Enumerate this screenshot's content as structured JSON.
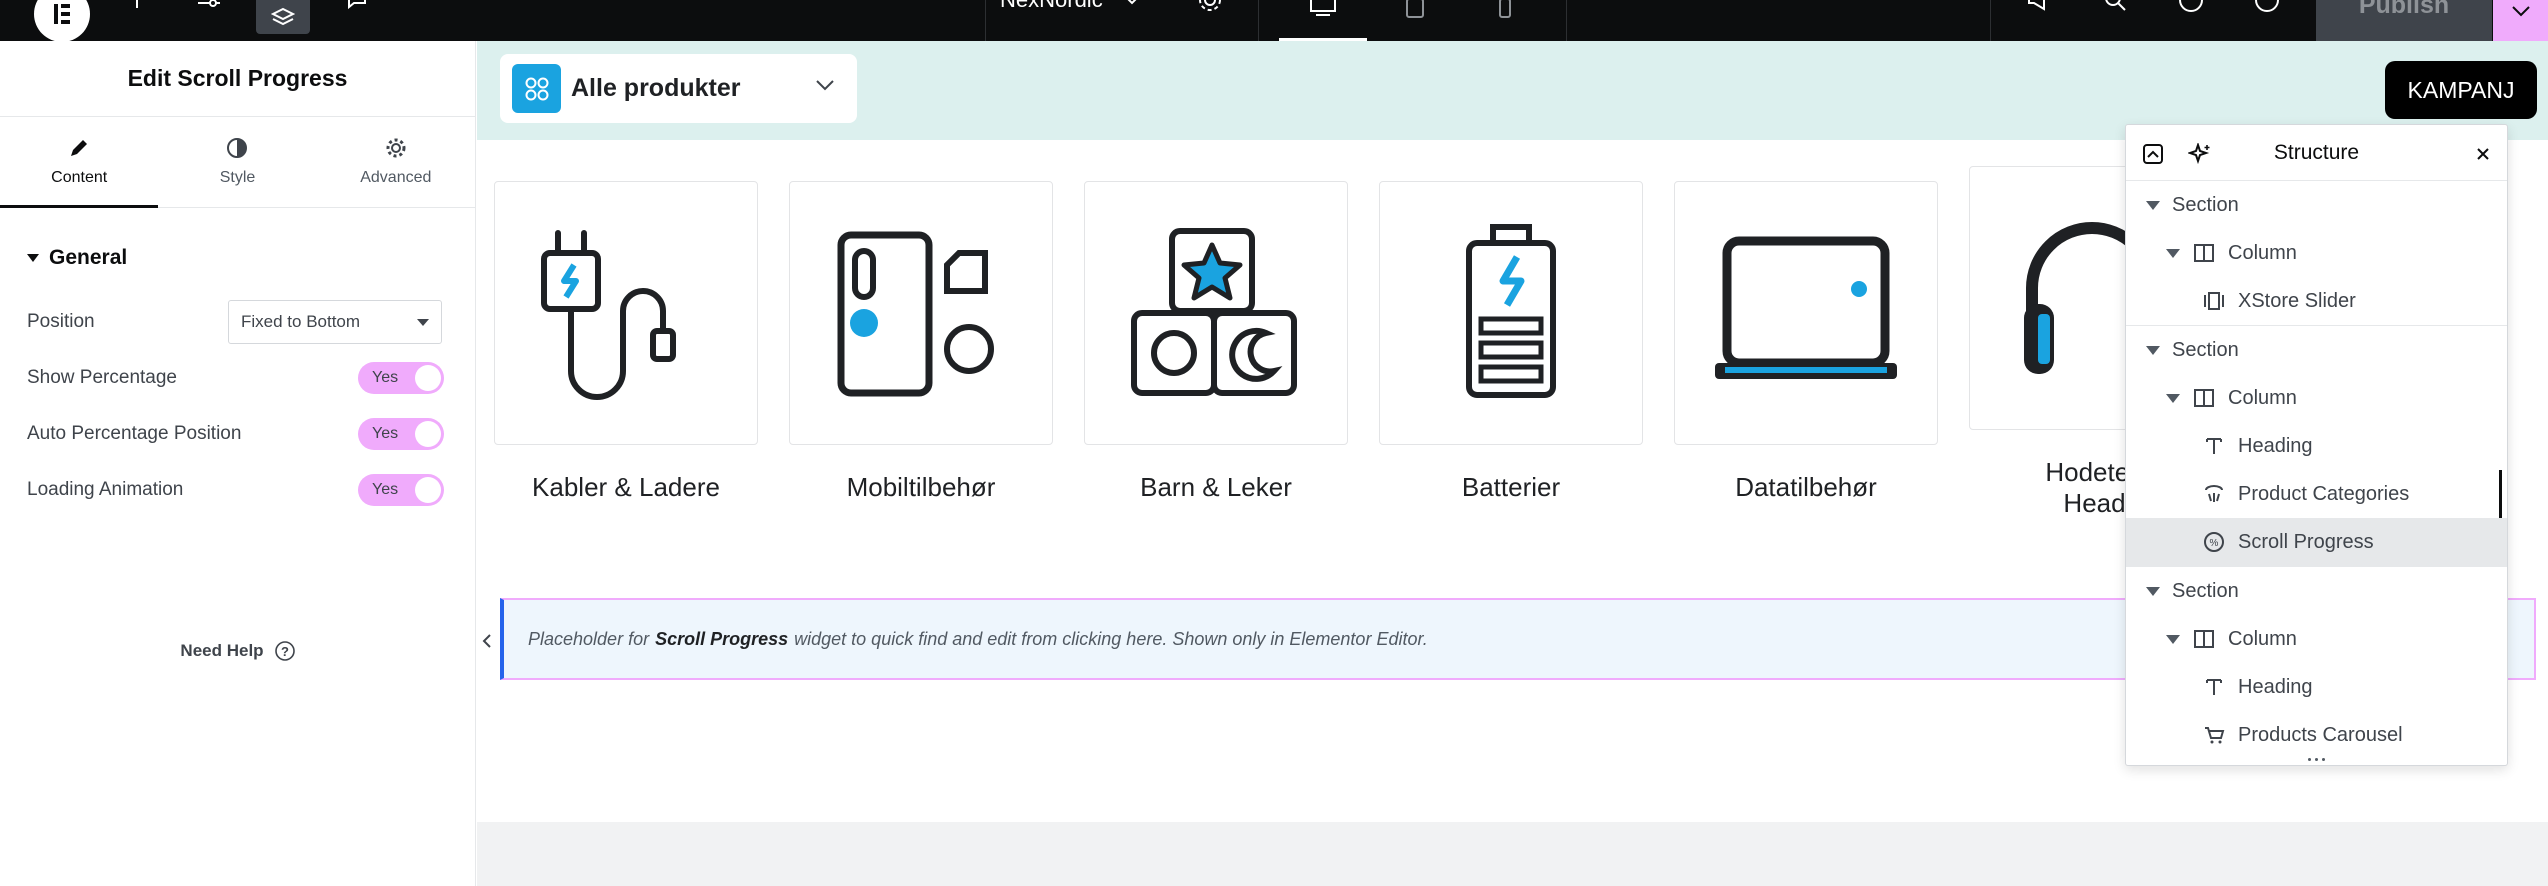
{
  "topbar": {
    "site_name": "NexNordic",
    "publish_label": "Publish"
  },
  "panel": {
    "title": "Edit Scroll Progress",
    "tabs": [
      {
        "label": "Content",
        "icon": "pencil-icon"
      },
      {
        "label": "Style",
        "icon": "contrast-icon"
      },
      {
        "label": "Advanced",
        "icon": "gear-icon"
      }
    ],
    "section_title": "General",
    "position": {
      "label": "Position",
      "value": "Fixed to Bottom"
    },
    "show_percentage": {
      "label": "Show Percentage",
      "value": "Yes"
    },
    "auto_percentage": {
      "label": "Auto Percentage Position",
      "value": "Yes"
    },
    "loading_animation": {
      "label": "Loading Animation",
      "value": "Yes"
    },
    "need_help": "Need Help"
  },
  "canvas": {
    "dropdown_label": "Alle produkter",
    "kampanj_label": "KAMPANJ",
    "categories": [
      {
        "label": "Kabler & Ladere",
        "icon": "charger-cable-icon"
      },
      {
        "label": "Mobiltilbehør",
        "icon": "phone-accessories-icon"
      },
      {
        "label": "Barn & Leker",
        "icon": "toy-blocks-icon"
      },
      {
        "label": "Batterier",
        "icon": "battery-icon"
      },
      {
        "label": "Datatilbehør",
        "icon": "laptop-icon"
      },
      {
        "label": "Hodetelef\nHeads",
        "icon": "headphones-icon"
      }
    ],
    "placeholder": {
      "prefix": "Placeholder for",
      "widget": "Scroll Progress",
      "suffix": "widget to quick find and edit from clicking here. Shown only in Elementor Editor."
    }
  },
  "structure": {
    "title": "Structure",
    "items": [
      {
        "label": "Section",
        "level": 0,
        "icon": "caret-down-icon"
      },
      {
        "label": "Column",
        "level": 1,
        "icon": "column-icon"
      },
      {
        "label": "XStore Slider",
        "level": 2,
        "icon": "slider-icon"
      },
      {
        "label": "Section",
        "level": 0,
        "icon": "caret-down-icon"
      },
      {
        "label": "Column",
        "level": 1,
        "icon": "column-icon"
      },
      {
        "label": "Heading",
        "level": 2,
        "icon": "heading-icon"
      },
      {
        "label": "Product Categories",
        "level": 2,
        "icon": "product-categories-icon"
      },
      {
        "label": "Scroll Progress",
        "level": 2,
        "icon": "scroll-progress-icon",
        "active": true
      },
      {
        "label": "Section",
        "level": 0,
        "icon": "caret-down-icon"
      },
      {
        "label": "Column",
        "level": 1,
        "icon": "column-icon"
      },
      {
        "label": "Heading",
        "level": 2,
        "icon": "heading-icon"
      },
      {
        "label": "Products Carousel",
        "level": 2,
        "icon": "cart-icon"
      }
    ]
  },
  "colors": {
    "accent": "#f0abfc",
    "brand_blue": "#1aa3e0",
    "topbar": "#0c0d0e",
    "hero_band": "#dcf0ee"
  }
}
